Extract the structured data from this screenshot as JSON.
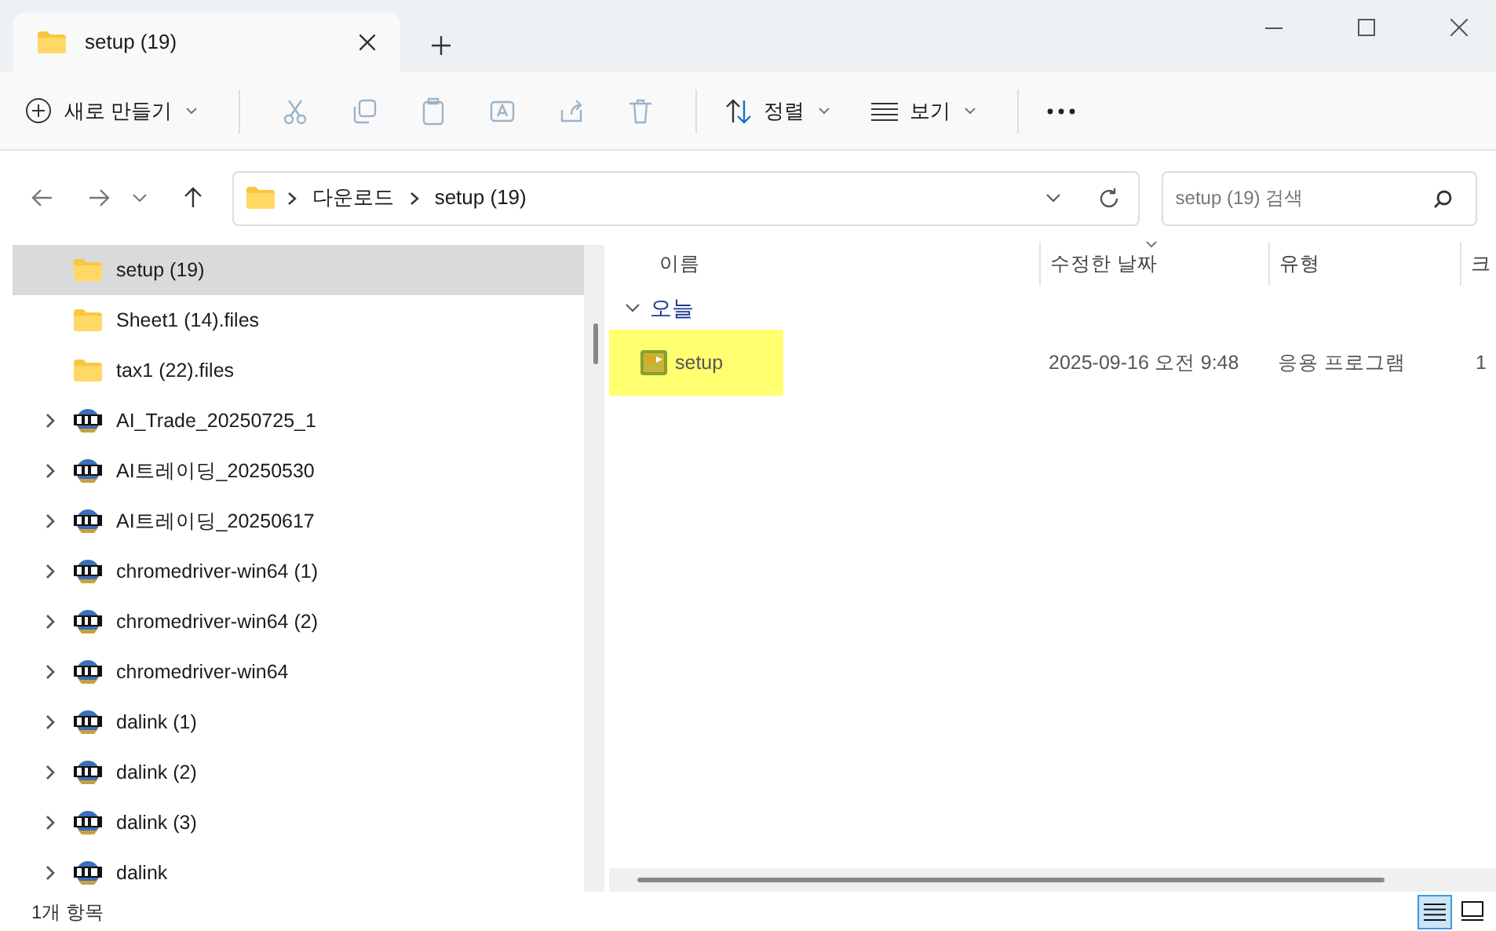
{
  "tab": {
    "title": "setup (19)"
  },
  "toolbar": {
    "new_button": "새로 만들기",
    "sort_button": "정렬",
    "view_button": "보기"
  },
  "address": {
    "crumbs": [
      "다운로드",
      "setup (19)"
    ],
    "search_placeholder": "setup (19) 검색"
  },
  "sidebar": {
    "items": [
      {
        "label": "setup (19)",
        "kind": "folder",
        "expandable": false,
        "selected": true
      },
      {
        "label": "Sheet1 (14).files",
        "kind": "folder",
        "expandable": false,
        "selected": false
      },
      {
        "label": "tax1 (22).files",
        "kind": "folder",
        "expandable": false,
        "selected": false
      },
      {
        "label": "AI_Trade_20250725_1",
        "kind": "zip",
        "expandable": true,
        "selected": false
      },
      {
        "label": "AI트레이딩_20250530",
        "kind": "zip",
        "expandable": true,
        "selected": false
      },
      {
        "label": "AI트레이딩_20250617",
        "kind": "zip",
        "expandable": true,
        "selected": false
      },
      {
        "label": "chromedriver-win64 (1)",
        "kind": "zip",
        "expandable": true,
        "selected": false
      },
      {
        "label": "chromedriver-win64 (2)",
        "kind": "zip",
        "expandable": true,
        "selected": false
      },
      {
        "label": "chromedriver-win64",
        "kind": "zip",
        "expandable": true,
        "selected": false
      },
      {
        "label": "dalink (1)",
        "kind": "zip",
        "expandable": true,
        "selected": false
      },
      {
        "label": "dalink (2)",
        "kind": "zip",
        "expandable": true,
        "selected": false
      },
      {
        "label": "dalink (3)",
        "kind": "zip",
        "expandable": true,
        "selected": false
      },
      {
        "label": "dalink",
        "kind": "zip",
        "expandable": true,
        "selected": false
      }
    ]
  },
  "files": {
    "columns": [
      "이름",
      "수정한 날짜",
      "유형",
      "크"
    ],
    "groups": [
      {
        "label": "오늘",
        "expanded": true,
        "rows": [
          {
            "name": "setup",
            "modified": "2025-09-16 오전 9:48",
            "type": "응용 프로그램",
            "column_4": "1",
            "highlighted": true
          }
        ]
      }
    ]
  },
  "status_bar": {
    "count": "1개 항목",
    "views": [
      {
        "kind": "details",
        "selected": true
      },
      {
        "kind": "tiles",
        "selected": false
      }
    ]
  }
}
